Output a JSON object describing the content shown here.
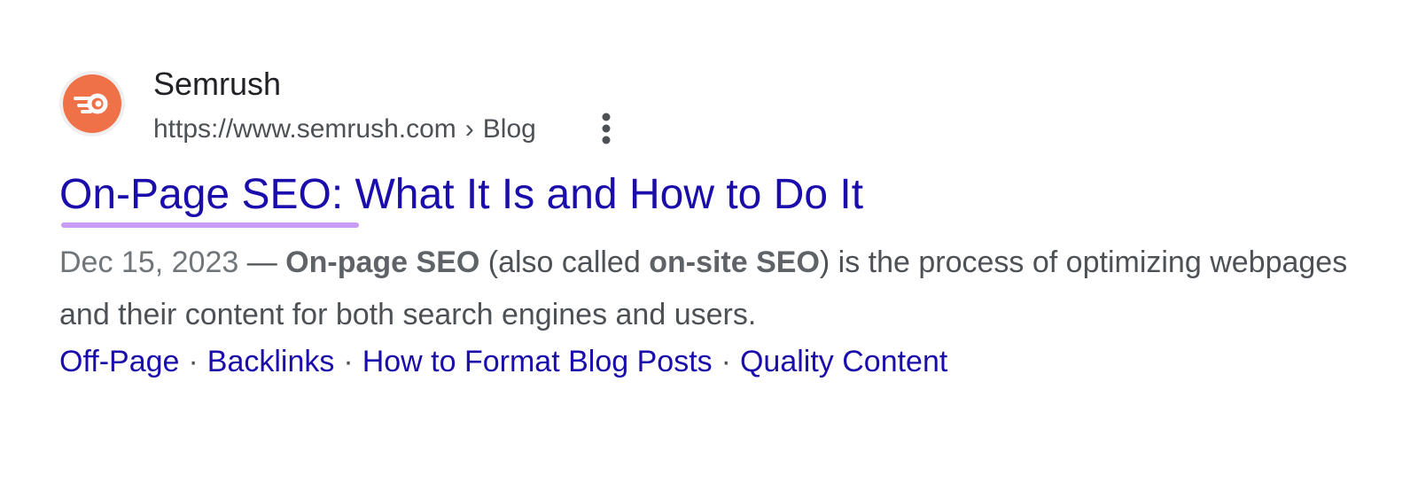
{
  "result": {
    "favicon": {
      "icon_name": "semrush-comet-logo-icon",
      "background_color": "#ef7147"
    },
    "site_name": "Semrush",
    "url": "https://www.semrush.com",
    "breadcrumb_separator": "›",
    "breadcrumb": "Blog",
    "more_icon": "more-vertical-icon",
    "title": "On-Page SEO: What It Is and How to Do It",
    "title_highlight_color": "#c89cf4",
    "snippet": {
      "date": "Dec 15, 2023",
      "dash": "—",
      "bold_1": "On-page SEO",
      "text_1": "(also called",
      "bold_2": "on-site SEO",
      "text_2": ") is the process of optimizing webpages and their content for both search engines and users."
    },
    "sitelinks": [
      "Off-Page",
      "Backlinks",
      "How to Format Blog Posts",
      "Quality Content"
    ],
    "sitelink_separator": "·"
  },
  "colors": {
    "link": "#1a0dab",
    "text": "#4d5156",
    "site_name": "#202124"
  }
}
